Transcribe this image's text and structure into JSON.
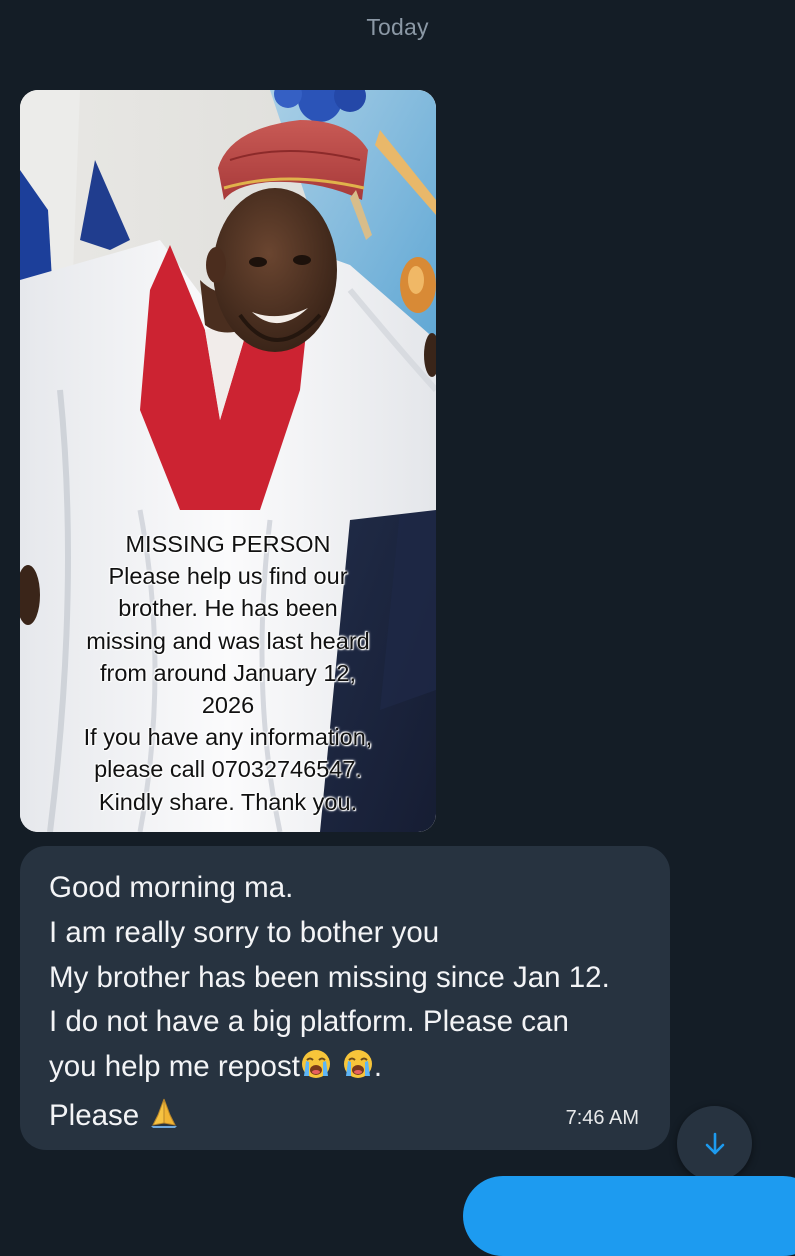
{
  "chat": {
    "date_separator": "Today"
  },
  "image_message": {
    "poster_lines": [
      "MISSING PERSON",
      "Please help us find our",
      "brother. He has been",
      "missing and was last heard",
      "from around January 12,",
      "2026",
      "If you have any information,",
      "please call 07032746547.",
      "Kindly share. Thank you."
    ]
  },
  "text_message": {
    "lines": [
      "Good morning ma.",
      "I am really sorry to bother you",
      "My brother has been missing since Jan 12.",
      "I do not have a big platform. Please can",
      "you help me repost",
      "Please"
    ],
    "line5_suffix": ".",
    "emoji_cry": "loudly-crying-face-emoji",
    "emoji_pray": "folded-hands-emoji",
    "time": "7:46 AM"
  },
  "scroll_button": {
    "icon": "arrow-down-icon"
  },
  "colors": {
    "background": "#141d26",
    "received_bubble": "#273340",
    "sent_bubble": "#1d9bf0",
    "accent": "#1d9bf0",
    "muted_text": "#8b98a5"
  }
}
